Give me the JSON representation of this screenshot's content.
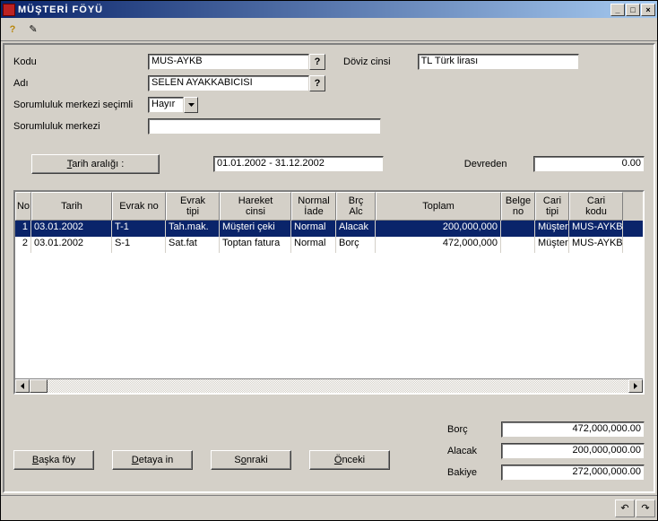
{
  "window": {
    "title": "MÜŞTERİ FÖYÜ"
  },
  "form": {
    "kodu_label": "Kodu",
    "kodu_value": "MUS-AYKB",
    "doviz_label": "Döviz cinsi",
    "doviz_value": "TL  Türk lirası",
    "adi_label": "Adı",
    "adi_value": "SELEN AYAKKABICISI",
    "sorumluluk_secimli_label": "Sorumluluk merkezi seçimli",
    "sorumluluk_secimli_value": "Hayır",
    "sorumluluk_label": "Sorumluluk merkezi",
    "sorumluluk_value": "",
    "tarih_btn": "Tarih aralığı :",
    "tarih_value": "01.01.2002 - 31.12.2002",
    "devreden_label": "Devreden",
    "devreden_value": "0.00"
  },
  "grid": {
    "headers": {
      "no": "No",
      "tarih": "Tarih",
      "evrak_no": "Evrak no",
      "evrak_tipi": "Evrak\ntipi",
      "hareket_cinsi": "Hareket\ncinsi",
      "normal_iade": "Normal\nİade",
      "brc_alc": "Brç\nAlc",
      "toplam": "Toplam",
      "belge_no": "Belge\nno",
      "cari_tipi": "Cari\ntipi",
      "cari_kodu": "Cari\nkodu"
    },
    "rows": [
      {
        "no": "1",
        "tarih": "03.01.2002",
        "evrak_no": "T-1",
        "evrak_tipi": "Tah.mak.",
        "hareket_cinsi": "Müşteri çeki",
        "normal_iade": "Normal",
        "brc_alc": "Alacak",
        "toplam": "200,000,000",
        "belge_no": "",
        "cari_tipi": "Müşteri",
        "cari_kodu": "MUS-AYKB",
        "selected": true
      },
      {
        "no": "2",
        "tarih": "03.01.2002",
        "evrak_no": "S-1",
        "evrak_tipi": "Sat.fat",
        "hareket_cinsi": "Toptan fatura",
        "normal_iade": "Normal",
        "brc_alc": "Borç",
        "toplam": "472,000,000",
        "belge_no": "",
        "cari_tipi": "Müşteri",
        "cari_kodu": "MUS-AYKB",
        "selected": false
      }
    ]
  },
  "buttons": {
    "baska_foy": "Başka föy",
    "detaya_in": "Detaya in",
    "sonraki": "Sonraki",
    "onceki": "Önceki"
  },
  "totals": {
    "borc_label": "Borç",
    "borc_value": "472,000,000.00",
    "alacak_label": "Alacak",
    "alacak_value": "200,000,000.00",
    "bakiye_label": "Bakiye",
    "bakiye_value": "272,000,000.00"
  }
}
